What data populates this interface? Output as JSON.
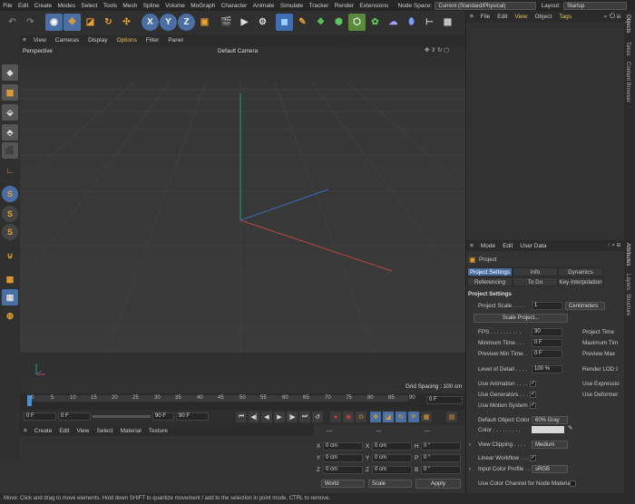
{
  "menubar": {
    "items": [
      "File",
      "Edit",
      "Create",
      "Modes",
      "Select",
      "Tools",
      "Mesh",
      "Spline",
      "Volume",
      "MoGraph",
      "Character",
      "Animate",
      "Simulate",
      "Tracker",
      "Render",
      "Extensions"
    ],
    "node_space_label": "Node Space:",
    "node_space_value": "Current (Standard/Physical)",
    "layout_label": "Layout:",
    "layout_value": "Startup"
  },
  "toolbar": {
    "axis_x": "X",
    "axis_y": "Y",
    "axis_z": "Z"
  },
  "viewport": {
    "menu": [
      "View",
      "Cameras",
      "Display",
      "Options",
      "Filter",
      "Panel"
    ],
    "projection": "Perspective",
    "camera": "Default Camera",
    "grid_spacing": "Grid Spacing : 100 cm"
  },
  "timeline": {
    "ticks": [
      "0",
      "5",
      "10",
      "15",
      "20",
      "25",
      "30",
      "35",
      "40",
      "45",
      "50",
      "55",
      "60",
      "65",
      "70",
      "75",
      "80",
      "85",
      "90"
    ],
    "current_frame": "0 F"
  },
  "transport": {
    "start": "0 F",
    "min": "0 F",
    "max": "90 F",
    "end": "90 F"
  },
  "material_manager": {
    "menu": [
      "Create",
      "Edit",
      "View",
      "Select",
      "Material",
      "Texture"
    ]
  },
  "coordinates": {
    "header": [
      "---",
      "---",
      "---"
    ],
    "rows": [
      {
        "a": "X",
        "av": "0 cm",
        "b": "X",
        "bv": "0 cm",
        "c": "H",
        "cv": "0 °"
      },
      {
        "a": "Y",
        "av": "0 cm",
        "b": "Y",
        "bv": "0 cm",
        "c": "P",
        "cv": "0 °"
      },
      {
        "a": "Z",
        "av": "0 cm",
        "b": "Z",
        "bv": "0 cm",
        "c": "B",
        "cv": "0 °"
      }
    ],
    "space": "World",
    "mode": "Scale",
    "apply": "Apply"
  },
  "object_manager": {
    "menu": [
      "File",
      "Edit",
      "View",
      "Object",
      "Tags"
    ]
  },
  "attributes": {
    "menu": [
      "Mode",
      "Edit",
      "User Data"
    ],
    "object": "Project",
    "tabs_row1": [
      "Project Settings",
      "Info",
      "Dynamics"
    ],
    "tabs_row2": [
      "Referencing",
      "To Do",
      "Key Interpolation"
    ],
    "section": "Project Settings",
    "project_scale_label": "Project Scale . . . .",
    "project_scale_value": "1",
    "project_scale_unit": "Centimeters",
    "scale_project_button": "Scale Project...",
    "fps_label": "FPS . . . . . . . . . .",
    "fps_value": "30",
    "project_time_label": "Project Time",
    "min_time_label": "Minimum Time . . .",
    "min_time_value": "0 F",
    "max_time_label": "Maximum Tim",
    "preview_min_label": "Preview Min Time. .",
    "preview_min_value": "0 F",
    "preview_max_label": "Preview Max",
    "lod_label": "Level of Detail . . . .",
    "lod_value": "100 %",
    "render_lod_label": "Render LOD I",
    "use_animation_label": "Use Animation . . . .",
    "use_expression_label": "Use Expressio",
    "use_generators_label": "Use Generators . . .",
    "use_deformer_label": "Use Deformer",
    "use_motion_label": "Use Motion System",
    "default_color_label": "Default Object Color",
    "default_color_value": "60% Gray",
    "color_label": "Color . . . . . . . . .",
    "view_clipping_label": "View Clipping . . . .",
    "view_clipping_value": "Medium",
    "linear_workflow_label": "Linear Workflow . . .",
    "input_profile_label": "Input Color Profile . .",
    "input_profile_value": "sRGB",
    "use_color_channel_label": "Use Color Channel for Node Material",
    "check": "✓"
  },
  "side_tabs_top": [
    "Objects",
    "Takes",
    "Content Browser"
  ],
  "side_tabs_bottom": [
    "Attributes",
    "Layers",
    "Structure"
  ],
  "statusbar": "Move: Click and drag to move elements. Hold down SHIFT to quantize movement / add to the selection in point mode, CTRL to remove.",
  "colors": {
    "accent_orange": "#e8a030",
    "accent_blue": "#4a8fd8",
    "bg": "#333333"
  }
}
